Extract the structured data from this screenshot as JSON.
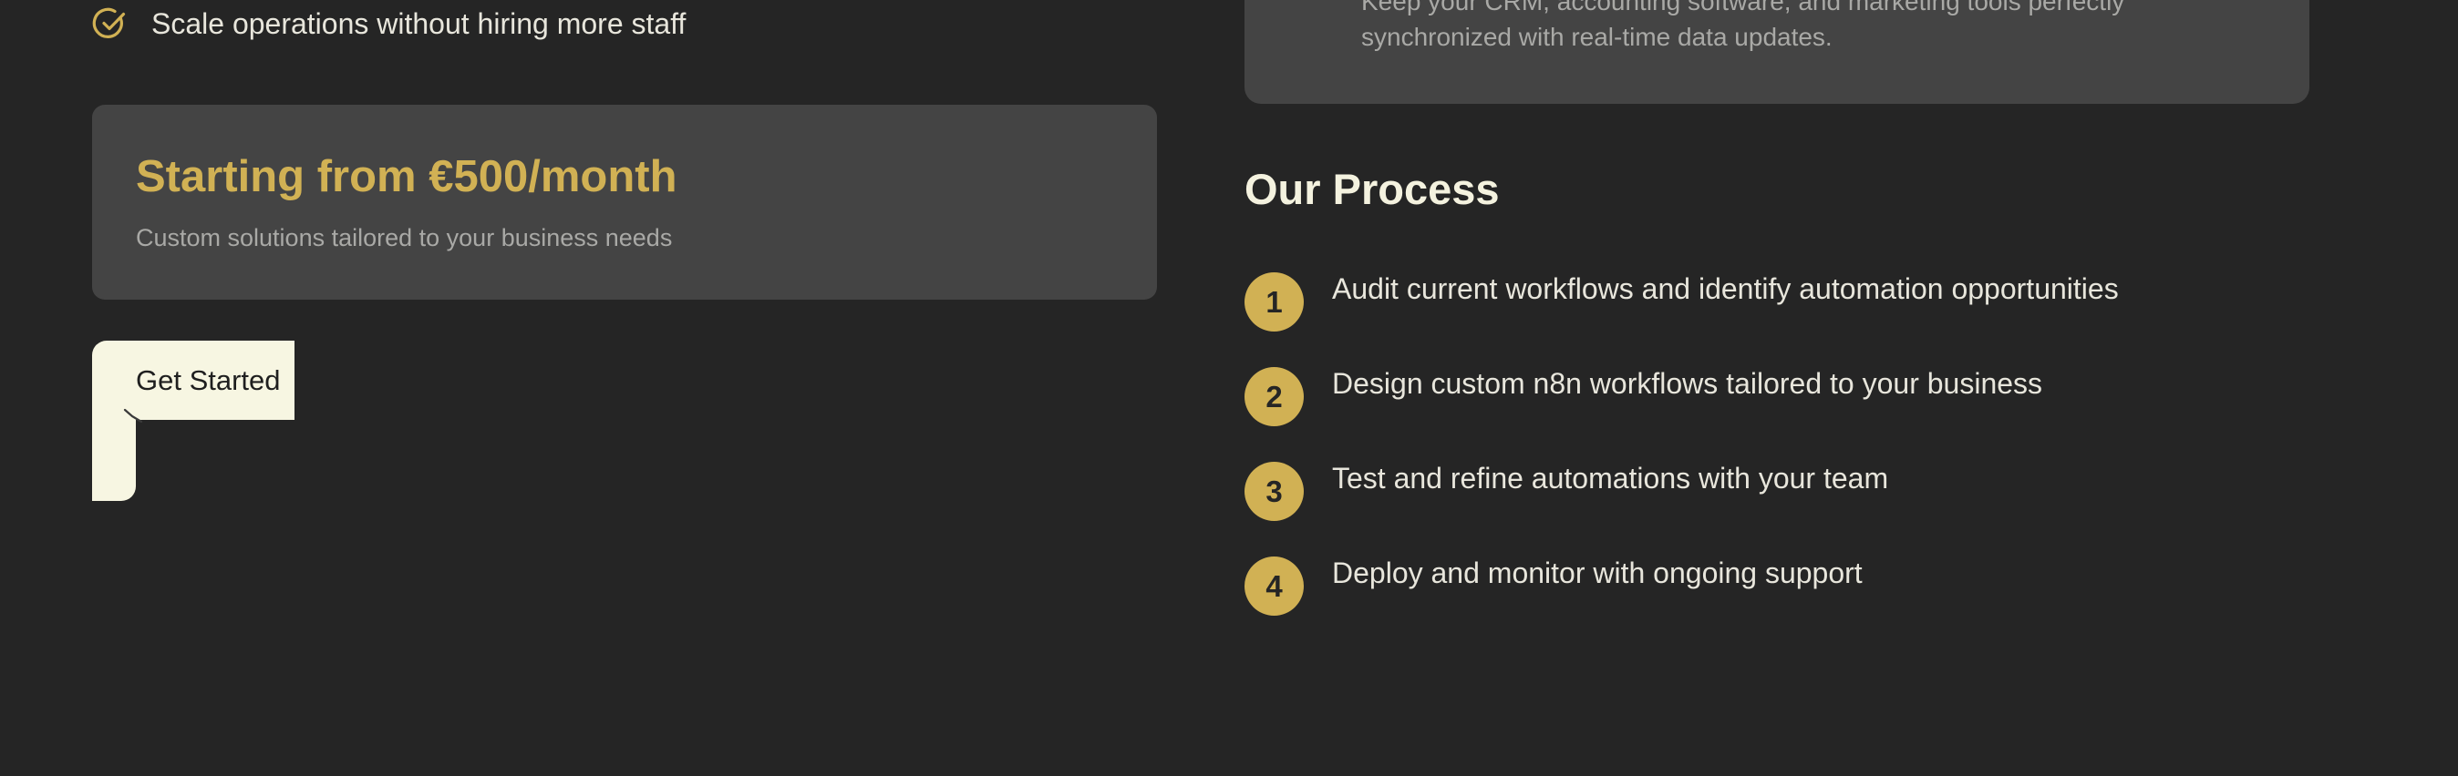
{
  "benefit": {
    "text": "Scale operations without hiring more staff",
    "icon": "check-circle-icon"
  },
  "pricing": {
    "title": "Starting from €500/month",
    "subtitle": "Custom solutions tailored to your business needs"
  },
  "cta": {
    "label": "Get Started",
    "icon": "arrow-icon"
  },
  "feature": {
    "text": "Keep your CRM, accounting software, and marketing tools perfectly synchronized with real-time data updates."
  },
  "process": {
    "title": "Our Process",
    "steps": [
      {
        "number": "1",
        "text": "Audit current workflows and identify automation opportunities"
      },
      {
        "number": "2",
        "text": "Design custom n8n workflows tailored to your business"
      },
      {
        "number": "3",
        "text": "Test and refine automations with your team"
      },
      {
        "number": "4",
        "text": "Deploy and monitor with ongoing support"
      }
    ]
  },
  "colors": {
    "background": "#252525",
    "card": "#444444",
    "accent": "#d1b154",
    "button": "#f7f6e2",
    "text_primary": "#e8e6dc",
    "text_muted": "#a9a9a6"
  }
}
